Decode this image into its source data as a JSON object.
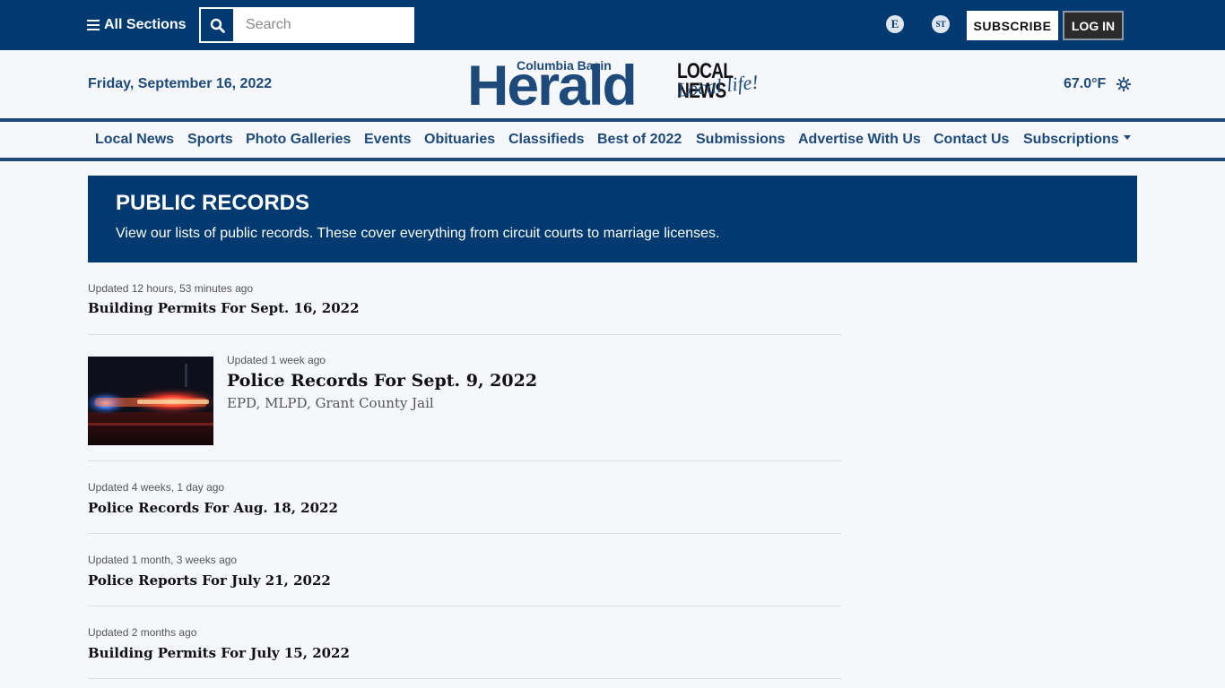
{
  "header": {
    "all_sections_label": "All Sections",
    "search_placeholder": "Search",
    "edition_e": "E",
    "edition_st": "ST",
    "subscribe_label": "SUBSCRIBE",
    "login_label": "LOG IN"
  },
  "masthead": {
    "date": "Friday, September 16, 2022",
    "logo_top": "Columbia Basin",
    "logo_main": "Herald",
    "logo_local_news": "LOCAL NEWS",
    "logo_tagline": "Local life!",
    "temperature": "67.0°F"
  },
  "nav": {
    "items": [
      "Local News",
      "Sports",
      "Photo Galleries",
      "Events",
      "Obituaries",
      "Classifieds",
      "Best of 2022",
      "Submissions",
      "Advertise With Us",
      "Contact Us",
      "Subscriptions"
    ]
  },
  "banner": {
    "title": "PUBLIC RECORDS",
    "description": "View our lists of public records. These cover everything from circuit courts to marriage licenses."
  },
  "records": [
    {
      "updated": "Updated 12 hours, 53 minutes ago",
      "title": "Building Permits For Sept. 16, 2022"
    },
    {
      "updated": "Updated 1 week ago",
      "title": "Police Records For Sept. 9, 2022",
      "subtitle": "EPD, MLPD, Grant County Jail"
    },
    {
      "updated": "Updated 4 weeks, 1 day ago",
      "title": "Police Records For Aug. 18, 2022"
    },
    {
      "updated": "Updated 1 month, 3 weeks ago",
      "title": "Police Reports For July 21, 2022"
    },
    {
      "updated": "Updated 2 months ago",
      "title": "Building Permits For July 15, 2022"
    }
  ],
  "colors": {
    "brand_navy": "#003a70",
    "link_blue": "#1d4a7a",
    "page_bg": "#f5f7fa"
  }
}
